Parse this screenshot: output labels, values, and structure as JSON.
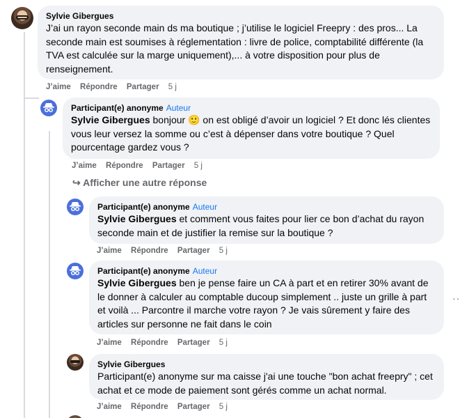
{
  "actions": {
    "like": "J’aime",
    "reply": "Répondre",
    "share": "Partager"
  },
  "more_replies": "Afficher une autre réponse",
  "comments": [
    {
      "author": "Sylvie Gibergues",
      "badge": "",
      "mention": "",
      "text": "J’ai un rayon seconde main ds ma boutique ; j’utilise le logiciel Freepry : des pros... La seconde main est soumises à réglementation : livre de police, comptabilité différente (la TVA est calculée sur la marge uniquement),... à votre disposition pour plus de renseignement.",
      "time": "5 j"
    },
    {
      "author": "Participant(e) anonyme",
      "badge": "Auteur",
      "mention": "Sylvie Gibergues",
      "text": " bonjour 🙂 on est obligé d’avoir un logiciel ? Et donc lés clientes vous leur versez la somme ou c’est à dépenser dans votre boutique ? Quel pourcentage gardez vous ?",
      "time": "5 j"
    },
    {
      "author": "Participant(e) anonyme",
      "badge": "Auteur",
      "mention": "Sylvie Gibergues",
      "text": " et comment vous faites pour lier ce bon d’achat du rayon seconde main et de justifier la remise sur la boutique ?",
      "time": "5 j"
    },
    {
      "author": "Participant(e) anonyme",
      "badge": "Auteur",
      "mention": "Sylvie Gibergues",
      "text": " ben je pense faire un CA à part et en retirer 30% avant de le donner à calculer au comptable ducoup simplement .. juste un grille à part et voilà ... Parcontre il marche votre rayon ? Je vais sûrement y faire des articles sur personne ne fait dans le coin",
      "time": "5 j"
    },
    {
      "author": "Sylvie Gibergues",
      "badge": "",
      "mention": "",
      "text": "Participant(e) anonyme sur ma caisse j'ai une touche \"bon achat freepry\" ; cet achat et ce mode de paiement sont gérés comme un achat normal.",
      "time": "5 j"
    }
  ],
  "colors": {
    "bubble_bg": "#f0f2f5",
    "badge": "#1877f2",
    "meta": "#65676b",
    "anon_avatar": "#4b6fdc"
  },
  "icons": [
    "user-photo-avatar",
    "anonymous-participant-icon",
    "reply-arrow-icon",
    "more-options-icon"
  ]
}
